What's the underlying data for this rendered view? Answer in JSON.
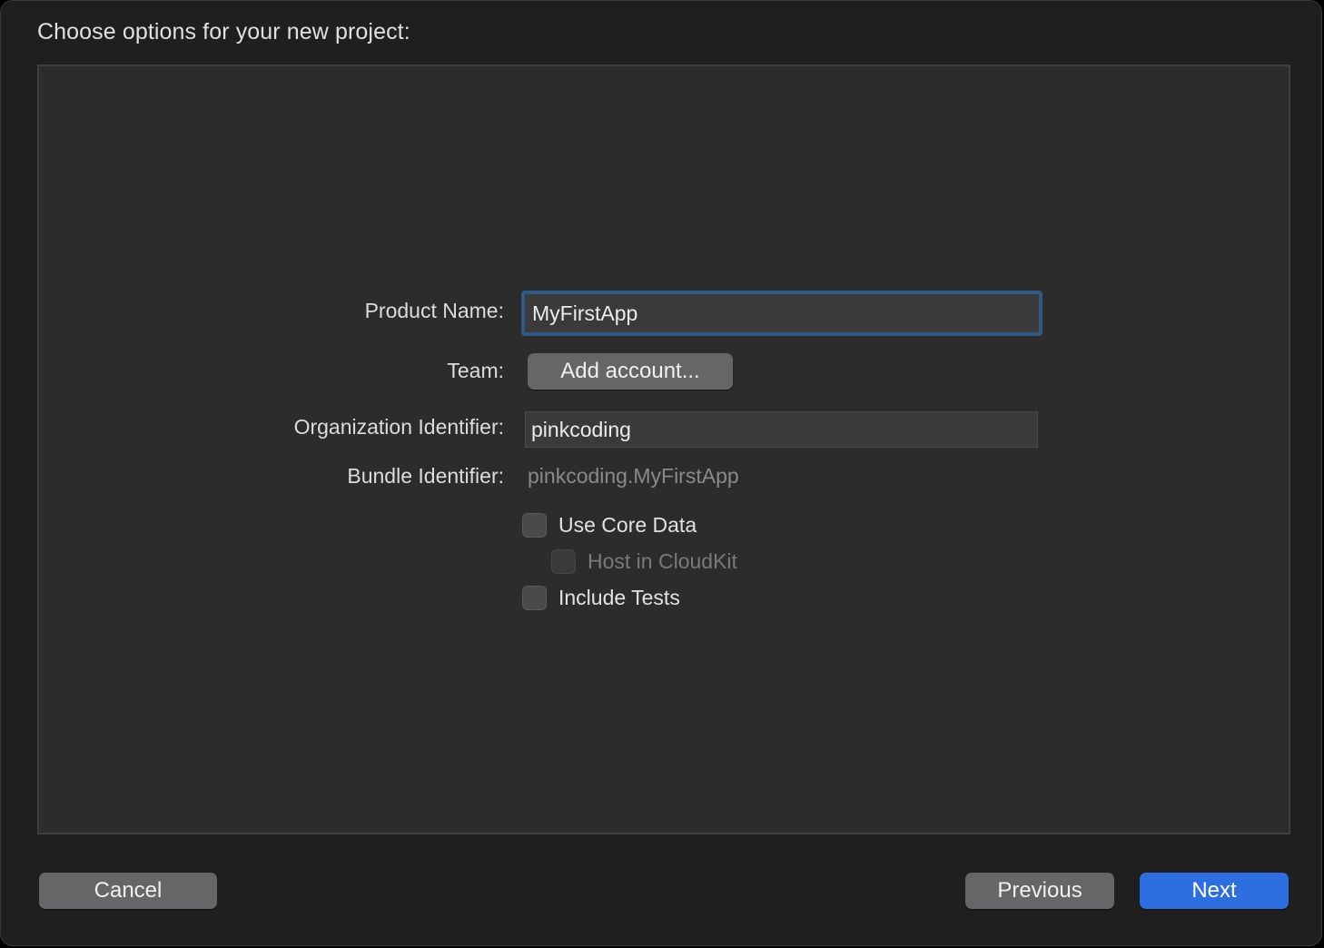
{
  "dialog": {
    "heading": "Choose options for your new project:"
  },
  "form": {
    "product_name_label": "Product Name:",
    "product_name_value": "MyFirstApp",
    "team_label": "Team:",
    "team_button": "Add account...",
    "org_identifier_label": "Organization Identifier:",
    "org_identifier_value": "pinkcoding",
    "bundle_identifier_label": "Bundle Identifier:",
    "bundle_identifier_value": "pinkcoding.MyFirstApp",
    "options": {
      "use_core_data": {
        "label": "Use Core Data",
        "checked": false,
        "enabled": true
      },
      "host_in_cloudkit": {
        "label": "Host in CloudKit",
        "checked": false,
        "enabled": false
      },
      "include_tests": {
        "label": "Include Tests",
        "checked": false,
        "enabled": true
      }
    }
  },
  "footer": {
    "cancel": "Cancel",
    "previous": "Previous",
    "next": "Next"
  },
  "colors": {
    "accent": "#2d6ee0",
    "focus_ring": "#2e5a85",
    "panel_bg": "#2c2c2c",
    "window_bg": "#1f1f1f"
  }
}
